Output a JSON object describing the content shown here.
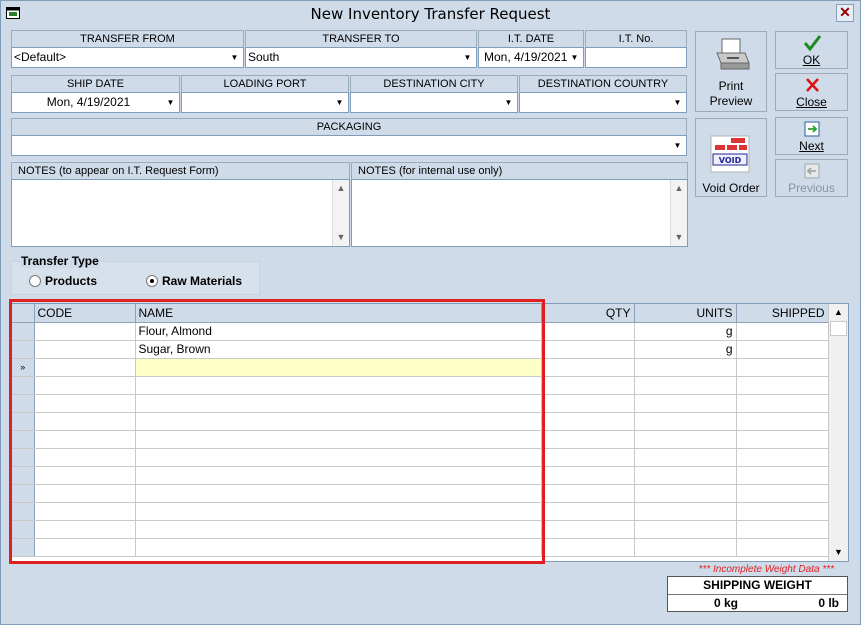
{
  "window": {
    "title": "New Inventory Transfer Request",
    "close_glyph": "✕"
  },
  "transfer_from": {
    "label": "TRANSFER FROM",
    "value": "<Default>"
  },
  "transfer_to": {
    "label": "TRANSFER TO",
    "value": "South"
  },
  "it_date": {
    "label": "I.T. DATE",
    "value": "Mon, 4/19/2021"
  },
  "it_no": {
    "label": "I.T. No.",
    "value": ""
  },
  "ship_date": {
    "label": "SHIP DATE",
    "value": "Mon, 4/19/2021"
  },
  "loading_port": {
    "label": "LOADING PORT",
    "value": ""
  },
  "destination_city": {
    "label": "DESTINATION CITY",
    "value": ""
  },
  "destination_country": {
    "label": "DESTINATION COUNTRY",
    "value": ""
  },
  "packaging": {
    "label": "PACKAGING",
    "value": ""
  },
  "notes_form": {
    "label": "NOTES (to appear on I.T. Request Form)",
    "value": ""
  },
  "notes_internal": {
    "label": "NOTES (for internal use only)",
    "value": ""
  },
  "buttons": {
    "print_preview": {
      "line1": "Print",
      "line2": "Preview"
    },
    "void_order": "Void Order",
    "ok": "OK",
    "close": "Close",
    "next": "Next",
    "previous": "Previous"
  },
  "transfer_type": {
    "title": "Transfer Type",
    "options": [
      "Products",
      "Raw Materials"
    ],
    "selected": "Raw Materials"
  },
  "grid": {
    "columns": [
      "CODE",
      "NAME",
      "QTY",
      "UNITS",
      "SHIPPED"
    ],
    "rows": [
      {
        "code": "",
        "name": "Flour, Almond",
        "qty": "",
        "units": "g",
        "shipped": ""
      },
      {
        "code": "",
        "name": "Sugar, Brown",
        "qty": "",
        "units": "g",
        "shipped": ""
      }
    ],
    "new_row_marker": "»"
  },
  "footer": {
    "warning": "*** Incomplete Weight Data ***",
    "shipping_weight_label": "SHIPPING WEIGHT",
    "kg": "0 kg",
    "lb": "0 lb"
  },
  "colors": {
    "window_bg": "#cfdbe9",
    "highlight_border": "#e02020",
    "current_row": "#ffffc8",
    "warning_text": "#e02020"
  },
  "icons": {
    "app": "window-icon",
    "print": "printer-icon",
    "void": "void-stamp-icon",
    "ok": "checkmark-icon",
    "close": "red-x-icon",
    "next": "next-page-icon",
    "previous": "previous-page-icon"
  }
}
